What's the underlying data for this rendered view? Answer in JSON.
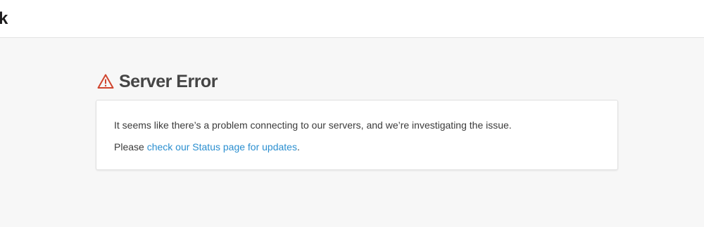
{
  "header": {
    "logo_fragment": "k"
  },
  "error": {
    "icon": "warning-triangle-icon",
    "icon_color": "#d0452e",
    "title": "Server Error",
    "message": "It seems like there’s a problem connecting to our servers, and we’re investigating the issue.",
    "status_prefix": "Please ",
    "status_link": "check our Status page for updates",
    "status_suffix": ".",
    "link_color": "#2b8fd0"
  }
}
